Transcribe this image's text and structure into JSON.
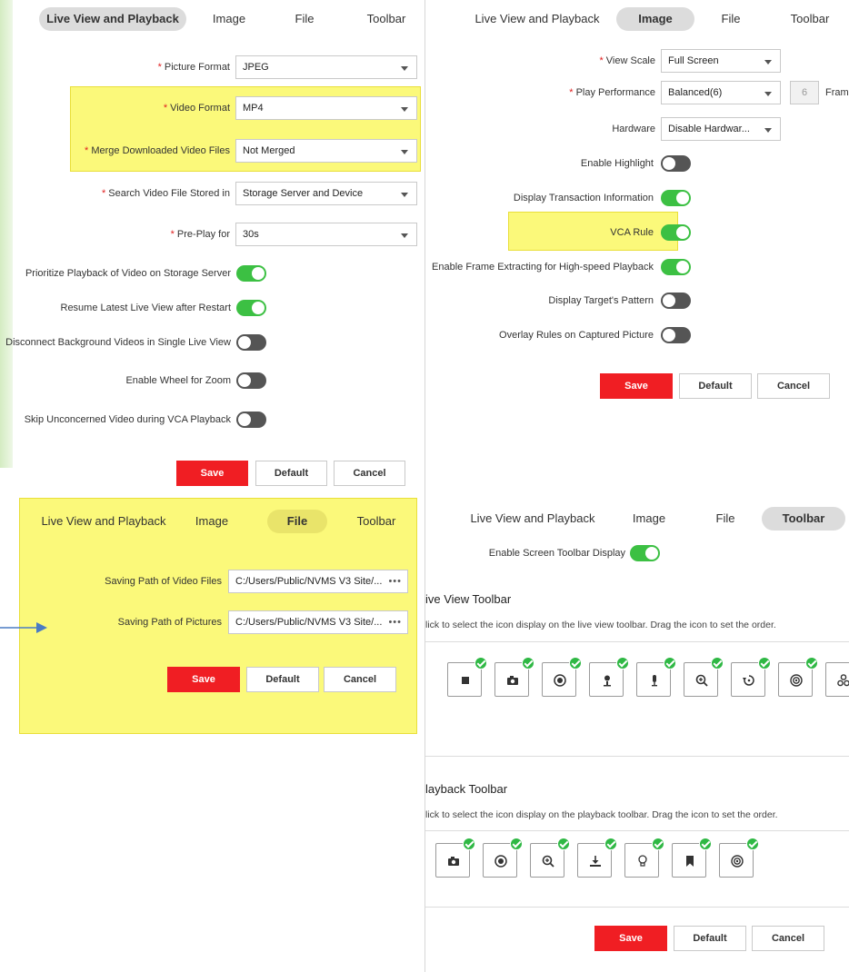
{
  "tabs": [
    "Live View and Playback",
    "Image",
    "File",
    "Toolbar"
  ],
  "buttons": {
    "save": "Save",
    "default": "Default",
    "cancel": "Cancel"
  },
  "live_view_panel": {
    "fields": [
      {
        "label": "Picture Format",
        "value": "JPEG"
      },
      {
        "label": "Video Format",
        "value": "MP4"
      },
      {
        "label": "Merge Downloaded Video Files",
        "value": "Not Merged"
      },
      {
        "label": "Search Video File Stored in",
        "value": "Storage Server and Device"
      },
      {
        "label": "Pre-Play for",
        "value": "30s"
      }
    ],
    "toggles": [
      {
        "label": "Prioritize Playback of Video on Storage Server",
        "on": true
      },
      {
        "label": "Resume Latest Live View after Restart",
        "on": true
      },
      {
        "label": "Disconnect Background Videos in Single Live View",
        "on": false
      },
      {
        "label": "Enable Wheel for Zoom",
        "on": false
      },
      {
        "label": "Skip Unconcerned Video during VCA Playback",
        "on": false
      }
    ]
  },
  "image_panel": {
    "fields": [
      {
        "label": "View Scale",
        "value": "Full Screen"
      },
      {
        "label": "Play Performance",
        "value": "Balanced(6)",
        "extra_value": "6",
        "extra_label": "Fram"
      },
      {
        "label": "Hardware",
        "value": "Disable Hardwar..."
      }
    ],
    "toggles": [
      {
        "label": "Enable Highlight",
        "on": false
      },
      {
        "label": "Display Transaction Information",
        "on": true
      },
      {
        "label": "VCA Rule",
        "on": true
      },
      {
        "label": "Enable Frame Extracting for High-speed Playback",
        "on": true
      },
      {
        "label": "Display Target's Pattern",
        "on": false
      },
      {
        "label": "Overlay Rules on Captured Picture",
        "on": false
      }
    ]
  },
  "file_panel": {
    "fields": [
      {
        "label": "Saving Path of Video Files",
        "value": "C:/Users/Public/NVMS V3 Site/..."
      },
      {
        "label": "Saving Path of Pictures",
        "value": "C:/Users/Public/NVMS V3 Site/..."
      }
    ],
    "browse_glyph": "•••"
  },
  "toolbar_panel": {
    "enable_label": "Enable Screen Toolbar Display",
    "enable_on": true,
    "live_title": "ive View Toolbar",
    "live_desc": "lick to select the icon display on the live view toolbar. Drag the icon to set the order.",
    "live_icons": [
      "stop-icon",
      "camera-icon",
      "record-icon",
      "person-icon",
      "microphone-icon",
      "zoom-icon",
      "rotate-icon",
      "target-icon",
      "link-icon"
    ],
    "playback_title": "layback Toolbar",
    "playback_desc": "lick to select the icon display on the playback toolbar. Drag the icon to set the order.",
    "playback_icons": [
      "camera-icon",
      "record-icon",
      "zoom-icon",
      "download-icon",
      "bulb-icon",
      "bookmark-icon",
      "target-icon"
    ]
  },
  "colors": {
    "accent_red": "#f01e23",
    "toggle_on": "#3cc043",
    "toggle_off": "#555555",
    "highlight": "#fbf97a",
    "check_green": "#2fb844"
  }
}
